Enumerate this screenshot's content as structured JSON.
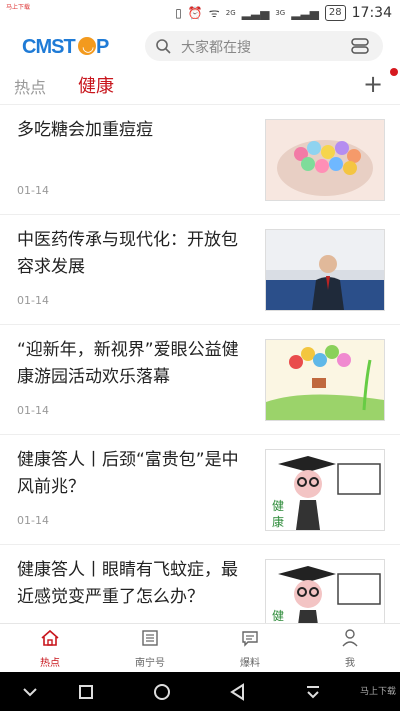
{
  "status": {
    "tiny_text": "马上下载",
    "network_1": "2G",
    "network_2": "3G",
    "battery": "28",
    "time": "17:34"
  },
  "header": {
    "logo_text": "CMSTOP",
    "search_placeholder": "大家都在搜"
  },
  "tabs": [
    "热点",
    "健康"
  ],
  "articles": [
    {
      "title": "多吃糖会加重痘痘",
      "date": "01-14"
    },
    {
      "title": "中医药传承与现代化：开放包容求发展",
      "date": "01-14"
    },
    {
      "title": "“迎新年，新视界”爱眼公益健康游园活动欢乐落幕",
      "date": "01-14"
    },
    {
      "title": "健康答人丨后颈“富贵包”是中风前兆？",
      "date": "01-14"
    },
    {
      "title": "健康答人丨眼睛有飞蚊症，最近感觉变严重了怎么办？",
      "date": ""
    }
  ],
  "bottom_nav": [
    "热点",
    "南宁号",
    "爆料",
    "我"
  ],
  "colors": {
    "accent": "#c8161d",
    "logo_blue": "#1f7bd6",
    "logo_orange": "#f39a1e"
  },
  "watermark": "马上下载"
}
